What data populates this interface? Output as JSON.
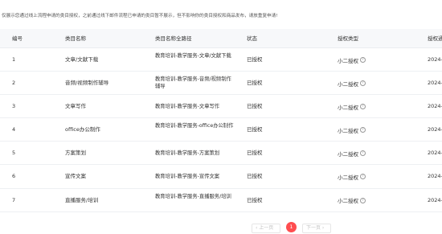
{
  "top_fade_text": "⁻⁻ ⁻⁻⁻⁻",
  "notice": "仅展示您通过线上流程申请的类目授权，之前通过线下邮件流程已申请的类目暂不展示，但不影响你的类目授权和商品发布，请放重复申请!",
  "table": {
    "headers": [
      "编号",
      "类目名称",
      "类目名称全路径",
      "状态",
      "授权类型",
      "授权通"
    ],
    "rows": [
      {
        "id": "1",
        "name": "文章/文献下载",
        "path": "教育培训-教学服务-文章/文献下载",
        "status": "已授权",
        "type": "小二授权",
        "date": "2024-"
      },
      {
        "id": "2",
        "name": "音频/视频制作辅导",
        "path": "教育培训-教学服务-音频/视频制作辅导",
        "status": "已授权",
        "type": "小二授权",
        "date": "2024-"
      },
      {
        "id": "3",
        "name": "文章写作",
        "path": "教育培训-教学服务-文章写作",
        "status": "已授权",
        "type": "小二授权",
        "date": "2024-"
      },
      {
        "id": "4",
        "name": "office办公制作",
        "path": "教育培训-教学服务-office办公制作",
        "status": "已授权",
        "type": "小二授权",
        "date": "2024-"
      },
      {
        "id": "5",
        "name": "方案策划",
        "path": "教育培训-教学服务-方案策划",
        "status": "已授权",
        "type": "小二授权",
        "date": "2024-"
      },
      {
        "id": "6",
        "name": "宣传文案",
        "path": "教育培训-教学服务-宣传文案",
        "status": "已授权",
        "type": "小二授权",
        "date": "2024-"
      },
      {
        "id": "7",
        "name": "直播服务/培训",
        "path": "教育培训-教学服务-直播服务/培训",
        "status": "已授权",
        "type": "小二授权",
        "date": "2024-"
      }
    ]
  },
  "pagination": {
    "prev_label": "‹ 上一页",
    "current_page": "1",
    "next_label": "下一页 ›"
  },
  "colors": {
    "accent": "#ff4d4f",
    "header_bg": "#f7f8fa",
    "border": "#ebedf0"
  },
  "icons": {
    "type_info": "question-circle-icon"
  }
}
